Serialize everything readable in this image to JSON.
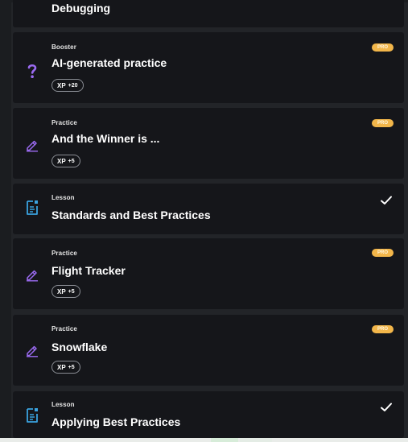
{
  "colors": {
    "pro_badge": "#f2b64a",
    "practice_icon": "#9b6bf2",
    "lesson_icon": "#3aa3e0",
    "booster_icon": "#9b6bf2"
  },
  "items": [
    {
      "title": "Debugging"
    },
    {
      "type": "Booster",
      "title": "AI-generated practice",
      "xp_label": "XP",
      "xp": "+20",
      "badge": "PRO",
      "icon": "question-mark-icon"
    },
    {
      "type": "Practice",
      "title": "And the Winner is ...",
      "xp_label": "XP",
      "xp": "+5",
      "badge": "PRO",
      "icon": "pencil-icon"
    },
    {
      "type": "Lesson",
      "title": "Standards and Best Practices",
      "completed": true,
      "icon": "document-icon"
    },
    {
      "type": "Practice",
      "title": "Flight Tracker",
      "xp_label": "XP",
      "xp": "+5",
      "badge": "PRO",
      "icon": "pencil-icon"
    },
    {
      "type": "Practice",
      "title": "Snowflake",
      "xp_label": "XP",
      "xp": "+5",
      "badge": "PRO",
      "icon": "pencil-icon"
    },
    {
      "type": "Lesson",
      "title": "Applying Best Practices",
      "completed": true,
      "icon": "document-icon"
    }
  ]
}
